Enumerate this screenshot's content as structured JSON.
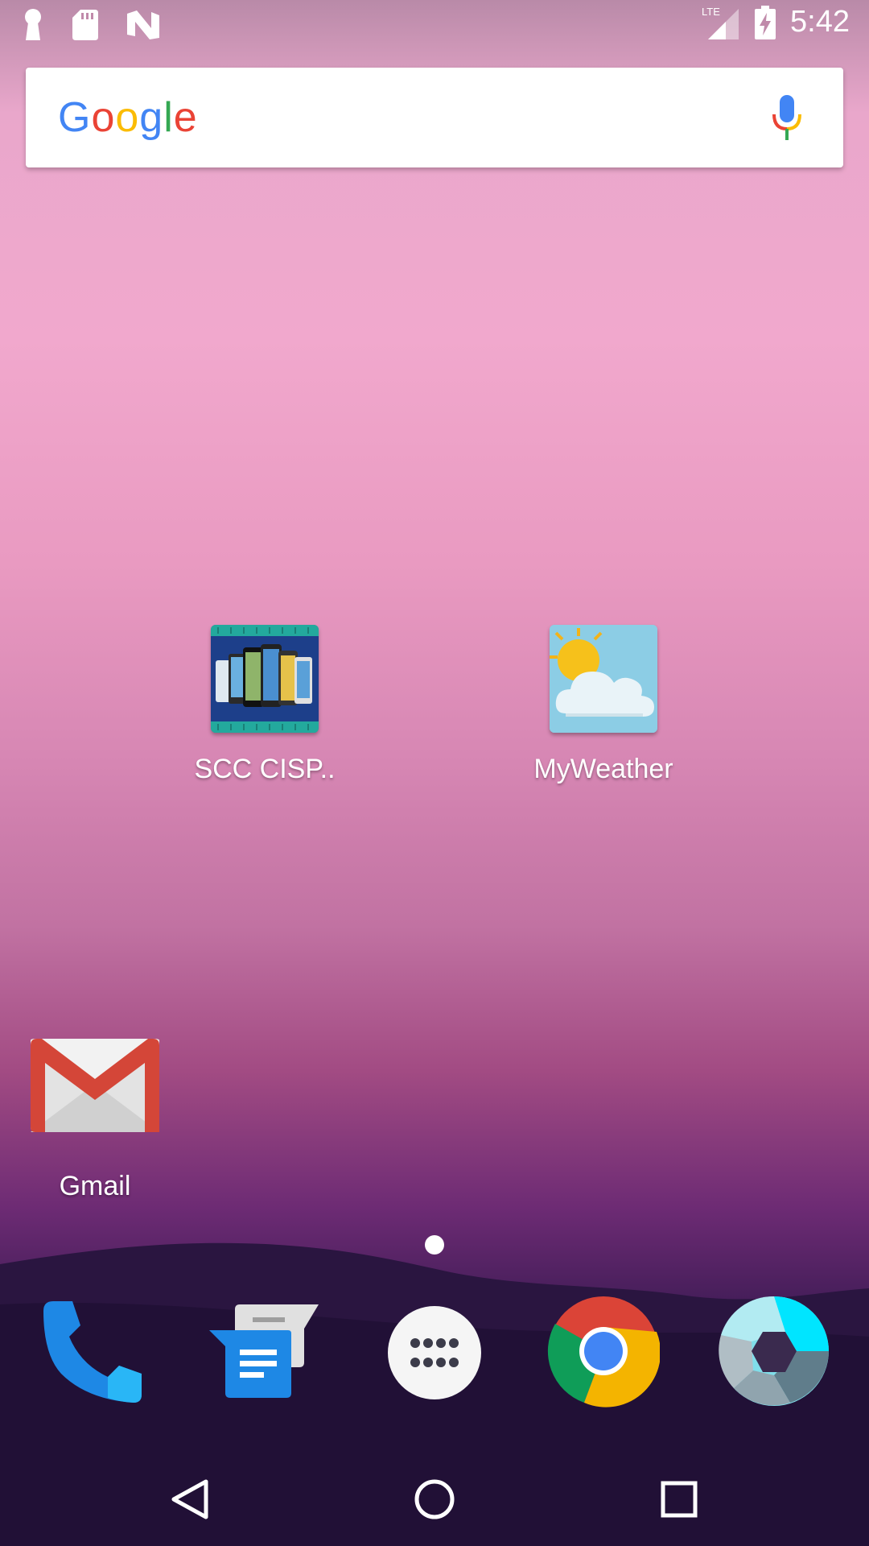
{
  "status_bar": {
    "time": "5:42",
    "network": "LTE",
    "left_icons": [
      "keyhole-icon",
      "sd-card-icon",
      "nfc-n-icon"
    ],
    "right_icons": [
      "signal-icon",
      "battery-charging-icon"
    ]
  },
  "search": {
    "logo_letters": [
      "G",
      "o",
      "o",
      "g",
      "l",
      "e"
    ],
    "logo_colors": [
      "#4285F4",
      "#EA4335",
      "#FBBC05",
      "#4285F4",
      "#34A853",
      "#EA4335"
    ],
    "mic_icon": "mic-icon"
  },
  "home_apps": [
    {
      "label": "SCC CISP..",
      "icon": "scc-cisp-app-icon"
    },
    {
      "label": "MyWeather",
      "icon": "weather-app-icon"
    },
    {
      "label": "Gmail",
      "icon": "gmail-icon"
    }
  ],
  "dock": [
    {
      "icon": "phone-icon"
    },
    {
      "icon": "messages-icon"
    },
    {
      "icon": "app-drawer-icon"
    },
    {
      "icon": "chrome-icon"
    },
    {
      "icon": "camera-icon"
    }
  ],
  "navigation": [
    "back-icon",
    "home-icon",
    "recents-icon"
  ],
  "page_indicator": {
    "pages": 1,
    "current": 1
  }
}
